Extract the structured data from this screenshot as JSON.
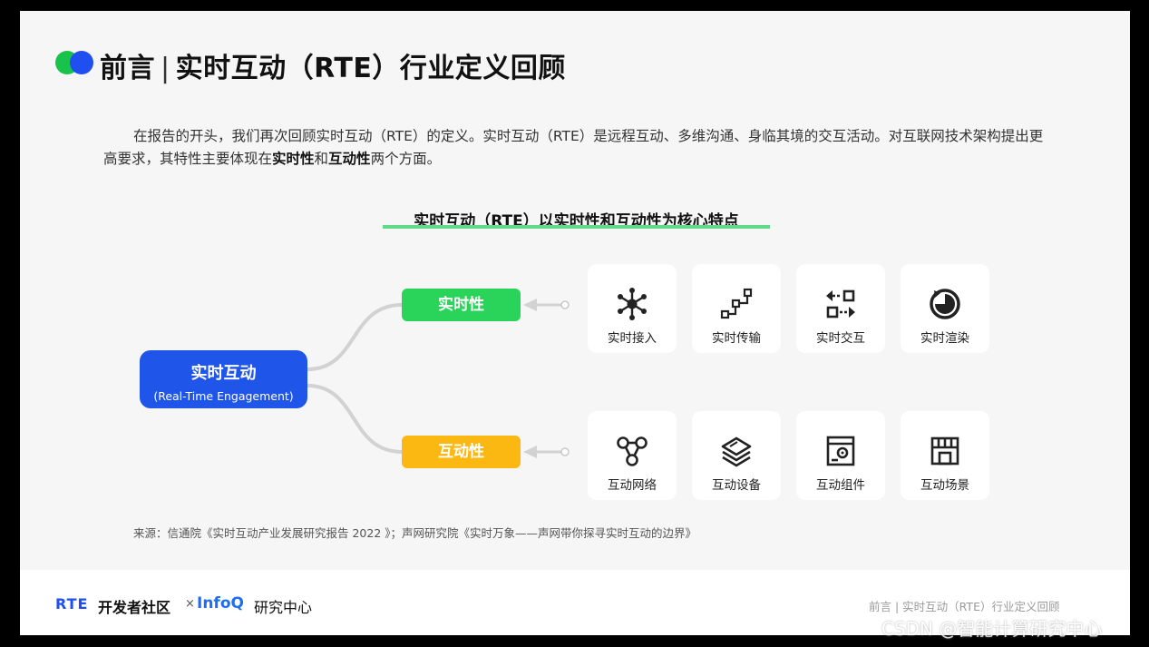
{
  "header": {
    "title_left": "前言",
    "separator": "|",
    "title_right": "实时互动（RTE）行业定义回顾"
  },
  "intro": {
    "part1": "在报告的开头，我们再次回顾实时互动（RTE）的定义。实时互动（RTE）是远程互动、多维沟通、身临其境的交互活动。对互联网技术架构提出更高要求，其特性主要体现在",
    "bold1": "实时性",
    "part2": "和",
    "bold2": "互动性",
    "part3": "两个方面。"
  },
  "diagram": {
    "subtitle": "实时互动（RTE）以实时性和互动性为核心特点",
    "root_label": "实时互动",
    "root_sub": "(Real-Time Engagement)",
    "branch_realtime": "实时性",
    "branch_interactive": "互动性",
    "realtime_cards": [
      {
        "label": "实时接入",
        "icon": "network-hub-icon"
      },
      {
        "label": "实时传输",
        "icon": "transfer-steps-icon"
      },
      {
        "label": "实时交互",
        "icon": "exchange-arrows-icon"
      },
      {
        "label": "实时渲染",
        "icon": "render-refresh-icon"
      }
    ],
    "interactive_cards": [
      {
        "label": "互动网络",
        "icon": "connected-nodes-icon"
      },
      {
        "label": "互动设备",
        "icon": "device-layers-icon"
      },
      {
        "label": "互动组件",
        "icon": "component-window-icon"
      },
      {
        "label": "互动场景",
        "icon": "scene-storefront-icon"
      }
    ]
  },
  "source": "来源：信通院《实时互动产业发展研究报告 2022 》；声网研究院《实时万象——声网带你探寻实时互动的边界》",
  "footer": {
    "logo_rte": "RTE",
    "logo_rte_text": "开发者社区",
    "logo_x": "×",
    "logo_infoq": "InfoQ",
    "logo_infoq_sub": "研究中心",
    "page_tag": "前言 | 实时互动（RTE）行业定义回顾",
    "watermark": "CSDN @智能计算研究中心"
  },
  "colors": {
    "brand_blue": "#1f55e8",
    "green": "#2ad35a",
    "yellow": "#fbb812",
    "underline_green": "#61d98a"
  }
}
